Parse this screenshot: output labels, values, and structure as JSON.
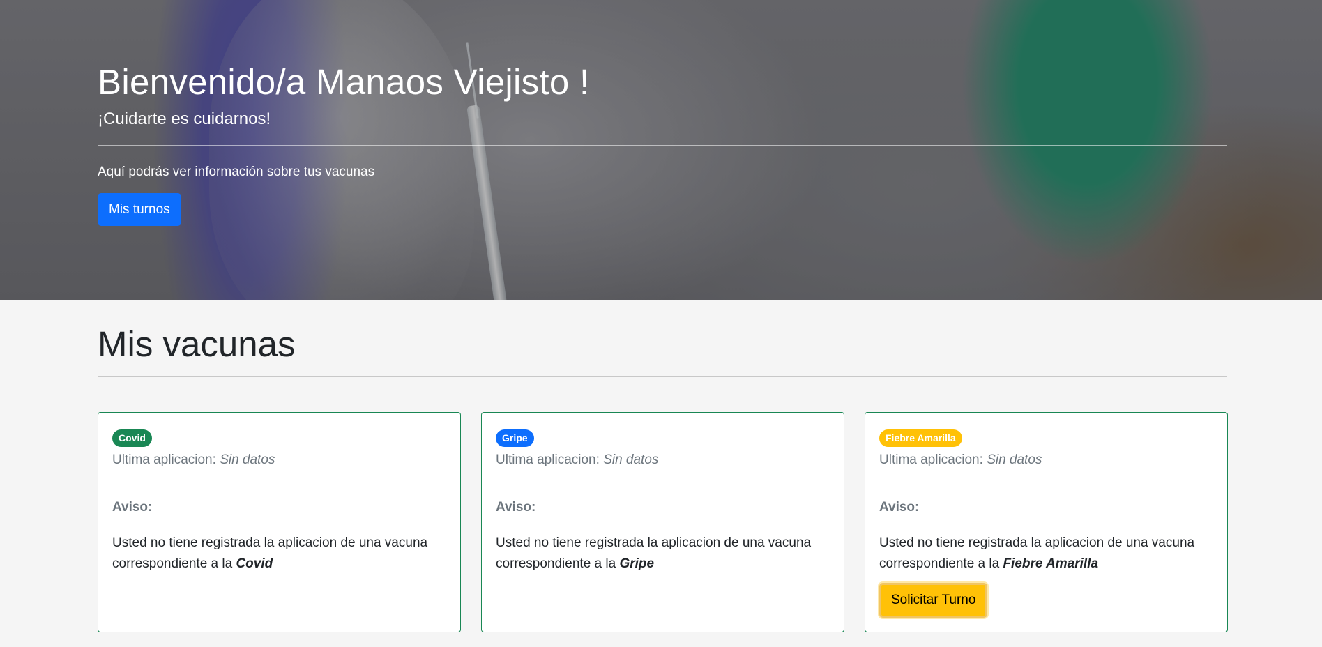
{
  "hero": {
    "title": "Bienvenido/a Manaos Viejisto !",
    "subtitle": "¡Cuidarte es cuidarnos!",
    "info": "Aquí podrás ver información sobre tus vacunas",
    "button_label": "Mis turnos",
    "button_color": "#0d6efd"
  },
  "section": {
    "title": "Mis vacunas"
  },
  "cards": [
    {
      "badge": "Covid",
      "badge_color": "#198754",
      "last_label": "Ultima aplicacion:",
      "last_value": "Sin datos",
      "notice_label": "Aviso:",
      "notice_text": "Usted no tiene registrada la aplicacion de una vacuna correspondiente a la",
      "vaccine_name": "Covid"
    },
    {
      "badge": "Gripe",
      "badge_color": "#0d6efd",
      "last_label": "Ultima aplicacion:",
      "last_value": "Sin datos",
      "notice_label": "Aviso:",
      "notice_text": "Usted no tiene registrada la aplicacion de una vacuna correspondiente a la",
      "vaccine_name": "Gripe"
    },
    {
      "badge": "Fiebre Amarilla",
      "badge_color": "#ffc107",
      "last_label": "Ultima aplicacion:",
      "last_value": "Sin datos",
      "notice_label": "Aviso:",
      "notice_text": "Usted no tiene registrada la aplicacion de una vacuna correspondiente a la",
      "vaccine_name": "Fiebre Amarilla",
      "action_label": "Solicitar Turno"
    }
  ],
  "colors": {
    "card_border": "#198754",
    "page_background": "#f5f5f5"
  }
}
